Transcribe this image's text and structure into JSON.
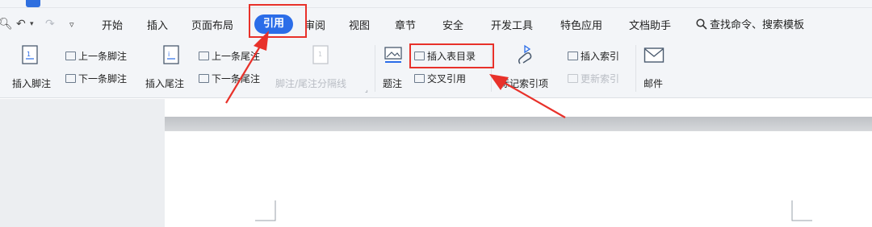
{
  "menubar": {
    "tabs": [
      "开始",
      "插入",
      "页面布局",
      "引用",
      "审阅",
      "视图",
      "章节",
      "安全",
      "开发工具",
      "特色应用",
      "文档助手"
    ],
    "active_tab": "引用",
    "search_text": "查找命令、搜索模板"
  },
  "ribbon": {
    "insert_footnote": "插入脚注",
    "prev_footnote": "上一条脚注",
    "next_footnote": "下一条脚注",
    "insert_endnote": "插入尾注",
    "prev_endnote": "上一条尾注",
    "next_endnote": "下一条尾注",
    "separator": "脚注/尾注分隔线",
    "caption": "题注",
    "insert_table_of_figures": "插入表目录",
    "cross_reference": "交叉引用",
    "mark_index_entry": "标记索引项",
    "insert_index": "插入索引",
    "update_index": "更新索引",
    "mail": "邮件"
  },
  "colors": {
    "accent": "#2b6de8",
    "highlight": "#e8312a"
  }
}
